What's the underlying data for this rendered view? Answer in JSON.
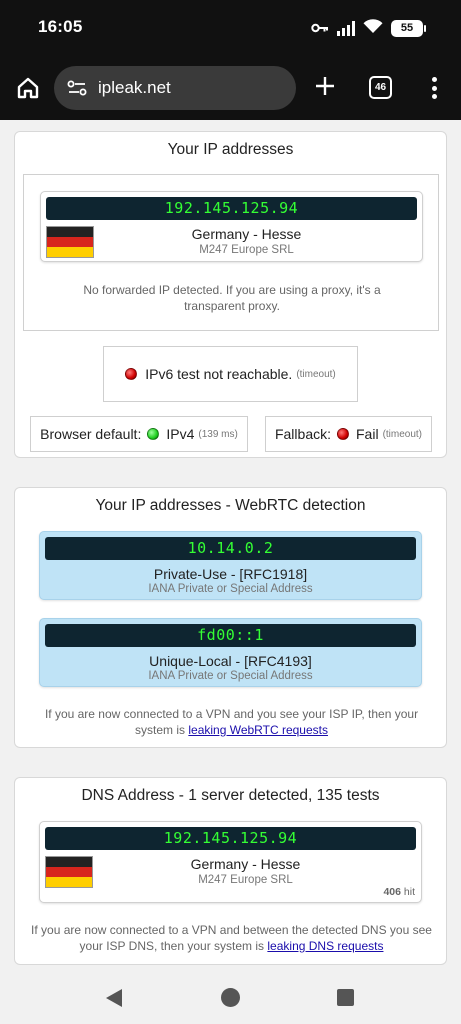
{
  "status": {
    "time": "16:05",
    "battery": "55"
  },
  "browser": {
    "url": "ipleak.net",
    "tab_count": "46"
  },
  "ip_section": {
    "title": "Your IP addresses",
    "ip": "192.145.125.94",
    "location": "Germany - Hesse",
    "isp": "M247 Europe SRL",
    "forward_note": "No forwarded IP detected. If you are using a proxy, it's a transparent proxy.",
    "ipv6_status": "IPv6 test not reachable.",
    "ipv6_timeout": "(timeout)",
    "browser_default_label": "Browser default:",
    "browser_default_value": "IPv4",
    "browser_default_ms": "(139 ms)",
    "fallback_label": "Fallback:",
    "fallback_value": "Fail",
    "fallback_timeout": "(timeout)"
  },
  "webrtc_section": {
    "title": "Your IP addresses - WebRTC detection",
    "entries": [
      {
        "ip": "10.14.0.2",
        "type": "Private-Use - [RFC1918]",
        "desc": "IANA Private or Special Address"
      },
      {
        "ip": "fd00::1",
        "type": "Unique-Local - [RFC4193]",
        "desc": "IANA Private or Special Address"
      }
    ],
    "note_prefix": "If you are now connected to a VPN and you see your ISP IP, then your system is",
    "note_link": "leaking WebRTC requests"
  },
  "dns_section": {
    "title": "DNS Address - 1 server detected, 135 tests",
    "ip": "192.145.125.94",
    "location": "Germany - Hesse",
    "isp": "M247 Europe SRL",
    "hits_count": "406",
    "hits_label": "hit",
    "note_prefix": "If you are now connected to a VPN and between the detected DNS you see your ISP DNS, then your system is",
    "note_link": "leaking DNS requests"
  },
  "colors": {
    "ip_display_bg": "#0e2530",
    "ip_display_text": "#34ff34",
    "webrtc_card_bg": "#bfe3f6",
    "link": "#1a0dab"
  },
  "icons": [
    "home-icon",
    "site-info-icon",
    "plus-icon",
    "tabs-icon",
    "more-icon",
    "key-icon",
    "signal-icon",
    "wifi-icon",
    "back-icon",
    "home-nav-icon",
    "recents-icon"
  ]
}
